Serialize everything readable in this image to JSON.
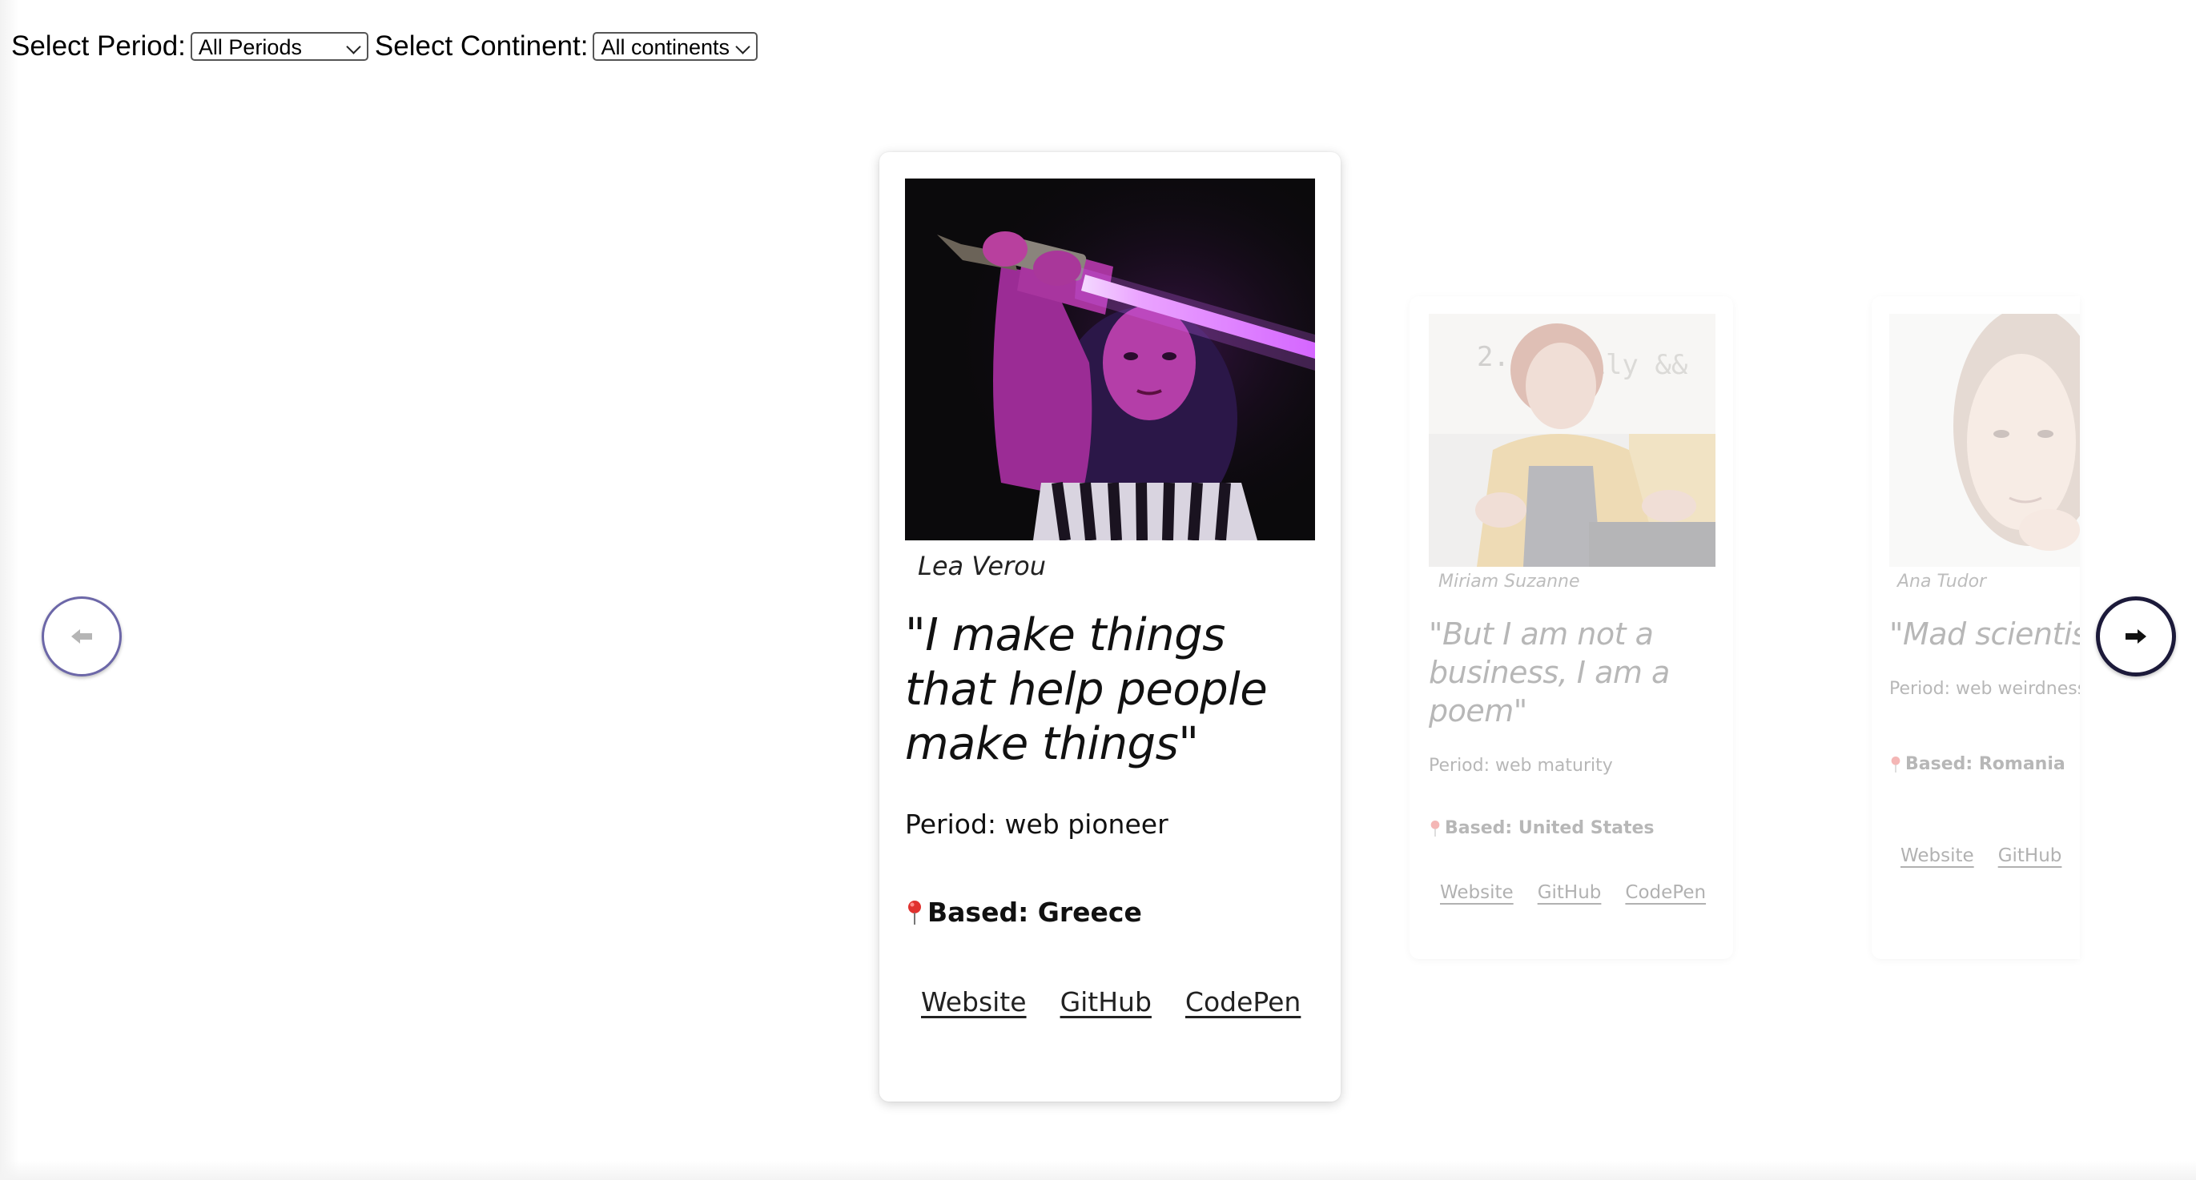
{
  "filters": {
    "period_label": "Select Period:",
    "period_value": "All Periods",
    "continent_label": "Select Continent:",
    "continent_value": "All continents"
  },
  "cards": [
    {
      "name": "Lea Verou",
      "quote": "\"I make things that help people make things\"",
      "period": "Period: web pioneer",
      "based": "Based: Greece",
      "links": [
        "Website",
        "GitHub",
        "CodePen"
      ]
    },
    {
      "name": "Miriam Suzanne",
      "quote": "\"But I am not a business, I am a poem\"",
      "period": "Period: web maturity",
      "based": "Based: United States",
      "links": [
        "Website",
        "GitHub",
        "CodePen"
      ]
    },
    {
      "name": "Ana Tudor",
      "quote": "\"Mad scientis",
      "period": "Period: web weirdness",
      "based": "Based: Romania",
      "links": [
        "Website",
        "GitHub"
      ]
    }
  ],
  "nav": {
    "prev_icon": "arrow-left-icon",
    "next_icon": "arrow-right-icon"
  },
  "colors": {
    "pin": "#e0322f",
    "prev_ring": "#6c67a8",
    "next_ring": "#1c1a3a",
    "lightsaber": "#d566ff"
  }
}
